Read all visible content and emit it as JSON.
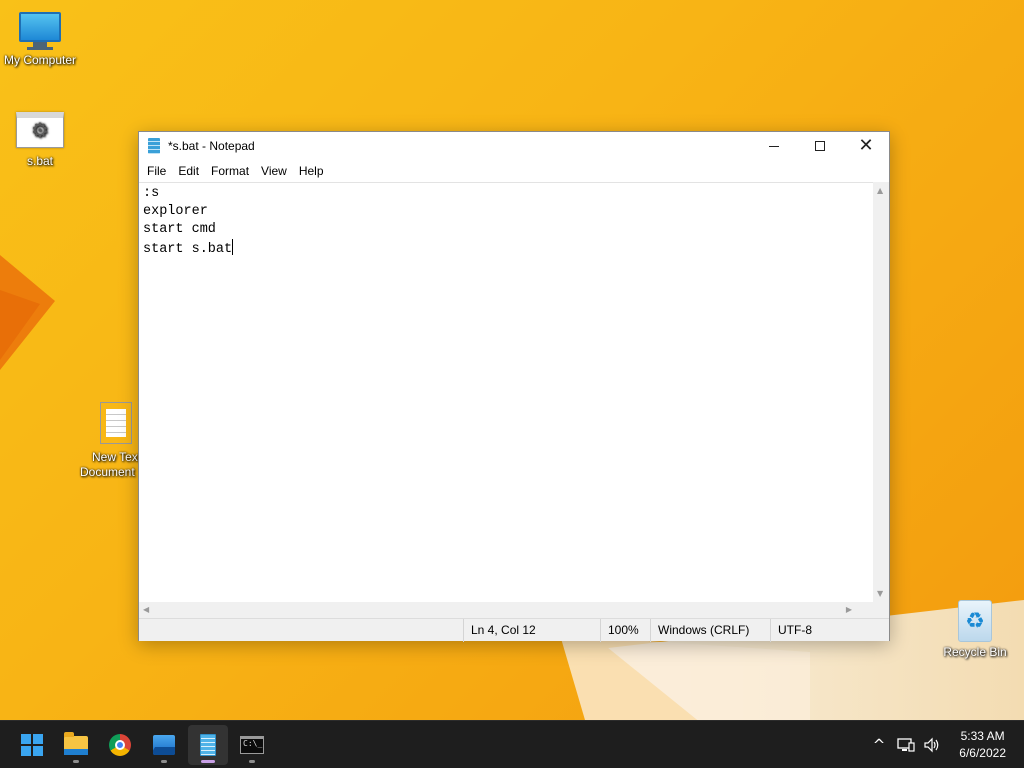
{
  "desktop": {
    "icons": [
      {
        "label": "My Computer",
        "icon": "monitor-icon"
      },
      {
        "label": "s.bat",
        "icon": "bat-file-icon"
      },
      {
        "label": "New Text Document",
        "label_line1": "New Text",
        "label_line2": "Document",
        "icon": "text-file-icon"
      },
      {
        "label": "Recycle Bin",
        "icon": "recycle-bin-icon"
      }
    ]
  },
  "window": {
    "title": "*s.bat - Notepad",
    "controls": {
      "minimize": "minimize",
      "maximize": "maximize",
      "close": "close"
    },
    "menu": [
      "File",
      "Edit",
      "Format",
      "View",
      "Help"
    ],
    "content_lines": [
      ":s",
      "explorer",
      "start cmd",
      "start s.bat"
    ],
    "status": {
      "position": "Ln 4, Col 12",
      "zoom": "100%",
      "line_ending": "Windows (CRLF)",
      "encoding": "UTF-8"
    }
  },
  "taskbar": {
    "apps": [
      {
        "name": "start",
        "icon": "windows-logo-icon"
      },
      {
        "name": "file-explorer",
        "icon": "folder-icon"
      },
      {
        "name": "chrome",
        "icon": "chrome-icon"
      },
      {
        "name": "photos",
        "icon": "photos-icon"
      },
      {
        "name": "notepad",
        "icon": "notepad-icon",
        "active": true
      },
      {
        "name": "terminal",
        "icon": "cmd-icon"
      }
    ],
    "tray": {
      "chevron": "^",
      "network": "network-icon",
      "volume": "volume-icon"
    },
    "clock": {
      "time": "5:33 AM",
      "date": "6/6/2022"
    }
  },
  "colors": {
    "wallpaper": "#f8b415",
    "taskbar": "#1e1e1e",
    "accent": "#3aa5f0"
  }
}
